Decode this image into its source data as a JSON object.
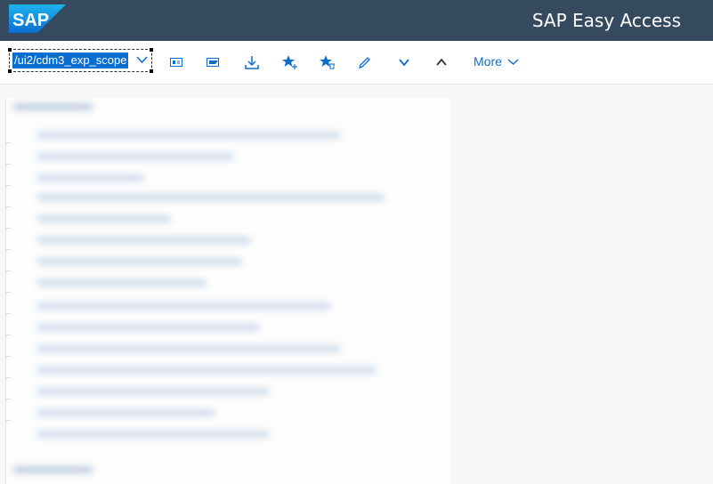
{
  "shell": {
    "logo_text": "SAP",
    "title": "SAP Easy Access",
    "brand_color": "#354a5f",
    "accent_color": "#0a6ed1"
  },
  "toolbar": {
    "command_value": "/ui2/cdm3_exp_scope",
    "buttons": [
      {
        "name": "user-menu-icon"
      },
      {
        "name": "sap-menu-icon"
      },
      {
        "name": "download-icon"
      },
      {
        "name": "add-favorite-icon"
      },
      {
        "name": "delete-favorite-icon"
      },
      {
        "name": "edit-icon"
      },
      {
        "name": "expand-down-icon"
      },
      {
        "name": "collapse-up-icon"
      }
    ],
    "more_label": "More"
  }
}
